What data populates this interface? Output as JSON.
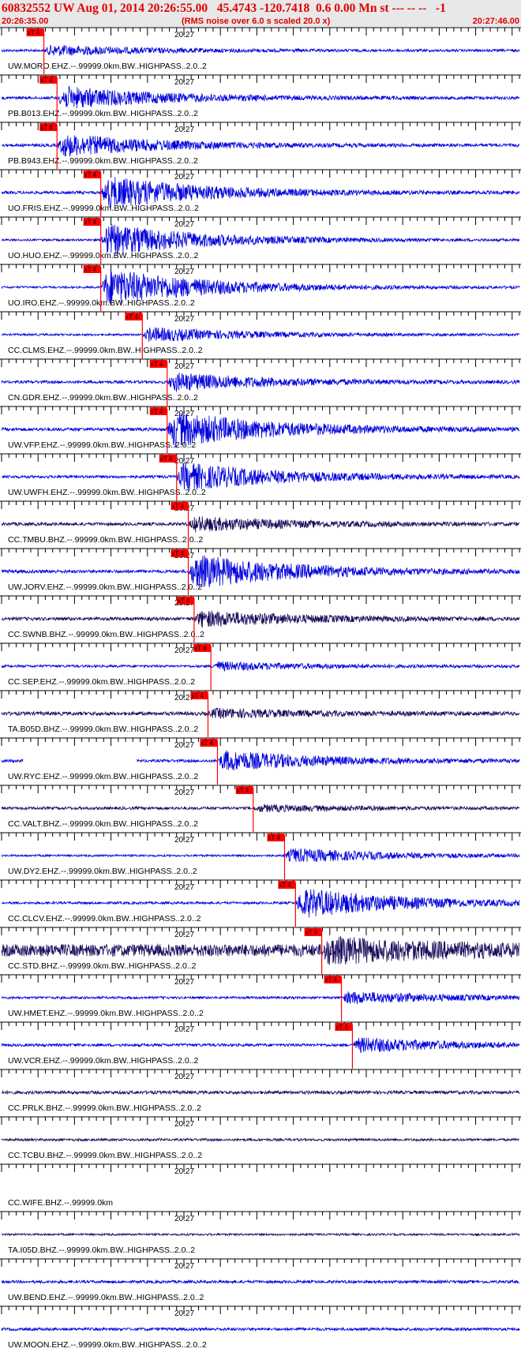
{
  "header": {
    "title": "60832552 UW Aug 01, 2014 20:26:55.00   45.4743 -120.7418  0.6 0.00 Mn st --- -- --   -1",
    "start_time": "20:26:35.00",
    "noise_note": "(RMS noise over 6.0 s scaled 20.0 x)",
    "end_time": "20:27:46.00"
  },
  "colors": {
    "title": "#e00000",
    "trace_blue": "#0000dd",
    "trace_navy": "#1a0a5a",
    "pick": "#ff0000",
    "axis": "#000000",
    "header_bg": "#e8e8e8"
  },
  "chart_data": {
    "type": "line",
    "title": "60832552 UW Aug 01, 2014 20:26:55.00",
    "x_start": "20:26:35.00",
    "x_end": "20:27:46.00",
    "x_range_seconds": [
      0,
      71
    ],
    "minute_mark_label": "20:27",
    "minute_mark_seconds": 25,
    "pick_label": "xT 4",
    "series": [
      {
        "label": "UW.MORO.EHZ.--.99999.0km.BW..HIGHPASS..2.0..2",
        "color": "#0000dd",
        "pick_s": 5.8,
        "amp": 0.25,
        "noise": 0.06,
        "gap": null
      },
      {
        "label": "PB.B013.EHZ.--.99999.0km.BW..HIGHPASS..2.0..2",
        "color": "#0000dd",
        "pick_s": 7.6,
        "amp": 0.55,
        "noise": 0.07,
        "gap": null
      },
      {
        "label": "PB.B943.EHZ.--.99999.0km.BW..HIGHPASS..2.0..2",
        "color": "#0000dd",
        "pick_s": 7.6,
        "amp": 0.55,
        "noise": 0.07,
        "gap": null
      },
      {
        "label": "UO.FRIS.EHZ.--.99999.0km.BW..HIGHPASS..2.0..2",
        "color": "#0000dd",
        "pick_s": 13.6,
        "amp": 0.8,
        "noise": 0.07,
        "gap": null
      },
      {
        "label": "UO.HUO.EHZ.--.99999.0km.BW..HIGHPASS..2.0..2",
        "color": "#0000dd",
        "pick_s": 13.6,
        "amp": 0.8,
        "noise": 0.05,
        "gap": null
      },
      {
        "label": "UO.IRO.EHZ.--.99999.0km.BW..HIGHPASS..2.0..2",
        "color": "#0000dd",
        "pick_s": 13.6,
        "amp": 0.95,
        "noise": 0.05,
        "gap": null
      },
      {
        "label": "CC.CLMS.EHZ.--.99999.0km.BW..HIGHPASS..2.0..2",
        "color": "#0000dd",
        "pick_s": 19.3,
        "amp": 0.35,
        "noise": 0.05,
        "gap": null
      },
      {
        "label": "CN.GDR.EHZ.--.99999.0km.BW..HIGHPASS..2.0..2",
        "color": "#0000dd",
        "pick_s": 22.7,
        "amp": 0.45,
        "noise": 0.07,
        "gap": null
      },
      {
        "label": "UW.VFP.EHZ.--.99999.0km.BW..HIGHPASS..2.0..2",
        "color": "#0000dd",
        "pick_s": 22.7,
        "amp": 0.9,
        "noise": 0.08,
        "gap": null
      },
      {
        "label": "UW.UWFH.EHZ.--.99999.0km.BW..HIGHPASS..2.0..2",
        "color": "#0000dd",
        "pick_s": 24.0,
        "amp": 0.7,
        "noise": 0.07,
        "gap": null
      },
      {
        "label": "CC.TMBU.BHZ.--.99999.0km.BW..HIGHPASS..2.0..2",
        "color": "#1a0a5a",
        "pick_s": 25.6,
        "amp": 0.35,
        "noise": 0.08,
        "gap": null
      },
      {
        "label": "UW.JORV.EHZ.--.99999.0km.BW..HIGHPASS..2.0..2",
        "color": "#0000dd",
        "pick_s": 25.6,
        "amp": 0.85,
        "noise": 0.08,
        "gap": null
      },
      {
        "label": "CC.SWNB.BHZ.--.99999.0km.BW..HIGHPASS..2.0..2",
        "color": "#1a0a5a",
        "pick_s": 26.4,
        "amp": 0.4,
        "noise": 0.08,
        "gap": null
      },
      {
        "label": "CC.SEP.EHZ.--.99999.0km.BW..HIGHPASS..2.0..2",
        "color": "#0000dd",
        "pick_s": 28.7,
        "amp": 0.2,
        "noise": 0.06,
        "gap": null
      },
      {
        "label": "TA.B05D.BHZ.--.99999.0km.BW..HIGHPASS..2.0..2",
        "color": "#1a0a5a",
        "pick_s": 28.3,
        "amp": 0.2,
        "noise": 0.09,
        "gap": null
      },
      {
        "label": "UW.RYC.EHZ.--.99999.0km.BW..HIGHPASS..2.0..2",
        "color": "#0000dd",
        "pick_s": 29.6,
        "amp": 0.5,
        "noise": 0.07,
        "gap": [
          3,
          18.5
        ]
      },
      {
        "label": "CC.VALT.BHZ.--.99999.0km.BW..HIGHPASS..2.0..2",
        "color": "#1a0a5a",
        "pick_s": 34.5,
        "amp": 0.15,
        "noise": 0.07,
        "gap": null
      },
      {
        "label": "UW.DY2.EHZ.--.99999.0km.BW..HIGHPASS..2.0..2",
        "color": "#0000dd",
        "pick_s": 38.8,
        "amp": 0.35,
        "noise": 0.05,
        "gap": null
      },
      {
        "label": "CC.CLCV.EHZ.--.99999.0km.BW..HIGHPASS..2.0..2",
        "color": "#0000dd",
        "pick_s": 40.3,
        "amp": 0.75,
        "noise": 0.06,
        "gap": null
      },
      {
        "label": "CC.STD.BHZ.--.99999.0km.BW..HIGHPASS..2.0..2",
        "color": "#1a0a5a",
        "pick_s": 43.9,
        "amp": 0.5,
        "noise": 0.3,
        "gap": null
      },
      {
        "label": "UW.HMET.EHZ.--.99999.0km.BW..HIGHPASS..2.0..2",
        "color": "#0000dd",
        "pick_s": 46.6,
        "amp": 0.3,
        "noise": 0.06,
        "gap": null
      },
      {
        "label": "UW.VCR.EHZ.--.99999.0km.BW..HIGHPASS..2.0..2",
        "color": "#0000dd",
        "pick_s": 48.1,
        "amp": 0.35,
        "noise": 0.07,
        "gap": null
      },
      {
        "label": "CC.PRLK.BHZ.--.99999.0km.BW..HIGHPASS..2.0..2",
        "color": "#1a0a5a",
        "pick_s": null,
        "amp": 0.0,
        "noise": 0.08,
        "gap": null
      },
      {
        "label": "CC.TCBU.BHZ.--.99999.0km.BW..HIGHPASS..2.0..2",
        "color": "#1a0a5a",
        "pick_s": null,
        "amp": 0.0,
        "noise": 0.06,
        "gap": null
      },
      {
        "label": "CC.WIFE.BHZ.--.99999.0km",
        "color": "#1a0a5a",
        "pick_s": null,
        "amp": 0.0,
        "noise": 0.0,
        "gap": null
      },
      {
        "label": "TA.I05D.BHZ.--.99999.0km.BW..HIGHPASS..2.0..2",
        "color": "#1a0a5a",
        "pick_s": null,
        "amp": 0.0,
        "noise": 0.05,
        "gap": null
      },
      {
        "label": "UW.BEND.EHZ.--.99999.0km.BW..HIGHPASS..2.0..2",
        "color": "#0000dd",
        "pick_s": null,
        "amp": 0.0,
        "noise": 0.07,
        "gap": null
      },
      {
        "label": "UW.MOON.EHZ.--.99999.0km.BW..HIGHPASS..2.0..2",
        "color": "#0000dd",
        "pick_s": null,
        "amp": 0.0,
        "noise": 0.07,
        "gap": null
      }
    ]
  }
}
